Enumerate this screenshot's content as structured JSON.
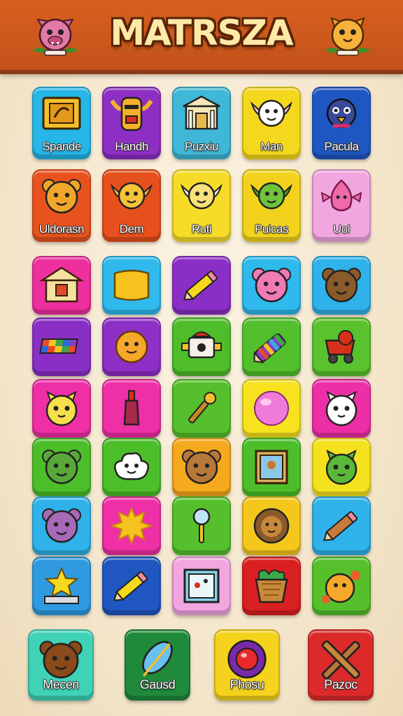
{
  "header": {
    "title": "MATRSZA"
  },
  "mascots": {
    "left": "pink-monster-icon",
    "right": "orange-cat-icon"
  },
  "rows": [
    [
      {
        "label": "Spande",
        "icon": "golden-frame-icon",
        "color": "#26b6e8"
      },
      {
        "label": "Handh",
        "icon": "tiki-mask-icon",
        "color": "#8e2fc4"
      },
      {
        "label": "Puzxiu",
        "icon": "temple-icon",
        "color": "#3fb7d6"
      },
      {
        "label": "Man",
        "icon": "winged-ghost-icon",
        "color": "#f4d81e"
      },
      {
        "label": "Pacula",
        "icon": "blue-bird-icon",
        "color": "#1f57c2"
      }
    ],
    [
      {
        "label": "Uldorasn",
        "icon": "lion-icon",
        "color": "#e8521f"
      },
      {
        "label": "Dem",
        "icon": "winged-mask-icon",
        "color": "#e5501c"
      },
      {
        "label": "Ruti",
        "icon": "angel-face-icon",
        "color": "#f6dc28"
      },
      {
        "label": "Puicas",
        "icon": "green-goblin-icon",
        "color": "#f2d21c"
      },
      {
        "label": "Uol",
        "icon": "pink-creature-icon",
        "color": "#f2a6e0"
      }
    ],
    [
      {
        "label": "",
        "icon": "shrine-icon",
        "color": "#ee2f9e"
      },
      {
        "label": "",
        "icon": "yellow-cushion-icon",
        "color": "#2fb9ec"
      },
      {
        "label": "",
        "icon": "pencil-icon",
        "color": "#8a2fc6"
      },
      {
        "label": "",
        "icon": "pink-bear-icon",
        "color": "#2fb9ec"
      },
      {
        "label": "",
        "icon": "brown-bear-icon",
        "color": "#2fb2ea"
      }
    ],
    [
      {
        "label": "",
        "icon": "color-blocks-icon",
        "color": "#8a2fc6"
      },
      {
        "label": "",
        "icon": "orange-cookie-icon",
        "color": "#8e2fc6"
      },
      {
        "label": "",
        "icon": "robot-head-icon",
        "color": "#4fbd2a"
      },
      {
        "label": "",
        "icon": "striped-crayon-icon",
        "color": "#52bf2c"
      },
      {
        "label": "",
        "icon": "red-cart-icon",
        "color": "#5ac22c"
      }
    ],
    [
      {
        "label": "",
        "icon": "yellow-cat-icon",
        "color": "#ee2fa6"
      },
      {
        "label": "",
        "icon": "bottle-icon",
        "color": "#ee2fa6"
      },
      {
        "label": "",
        "icon": "microphone-icon",
        "color": "#56c02c"
      },
      {
        "label": "",
        "icon": "pink-ball-icon",
        "color": "#f6e21e"
      },
      {
        "label": "",
        "icon": "white-cat-icon",
        "color": "#ec2fa6"
      }
    ],
    [
      {
        "label": "",
        "icon": "green-bear-icon",
        "color": "#4cbe2a"
      },
      {
        "label": "",
        "icon": "cloud-face-icon",
        "color": "#4cbe2a"
      },
      {
        "label": "",
        "icon": "teddy-bear-icon",
        "color": "#f5a91c"
      },
      {
        "label": "",
        "icon": "portrait-icon",
        "color": "#4cbe2a"
      },
      {
        "label": "",
        "icon": "green-cat-icon",
        "color": "#f5e21e"
      }
    ],
    [
      {
        "label": "",
        "icon": "purple-bear-icon",
        "color": "#2fb2ea"
      },
      {
        "label": "",
        "icon": "sun-icon",
        "color": "#ee2fa6"
      },
      {
        "label": "",
        "icon": "magnifier-icon",
        "color": "#56c02c"
      },
      {
        "label": "",
        "icon": "lion-face-icon",
        "color": "#f5c71c"
      },
      {
        "label": "",
        "icon": "pen-icon",
        "color": "#2fb2ea"
      }
    ],
    [
      {
        "label": "",
        "icon": "star-trophy-icon",
        "color": "#2f9ae0"
      },
      {
        "label": "",
        "icon": "pencil-icon",
        "color": "#1f56c0"
      },
      {
        "label": "",
        "icon": "picture-frame-icon",
        "color": "#f2a6e0"
      },
      {
        "label": "",
        "icon": "plant-basket-icon",
        "color": "#d92020"
      },
      {
        "label": "",
        "icon": "orange-blob-icon",
        "color": "#56c02c"
      }
    ]
  ],
  "bottom": [
    {
      "label": "Mecen",
      "icon": "bear-icon",
      "color": "#3fd2b6"
    },
    {
      "label": "Gausd",
      "icon": "feather-leaf-icon",
      "color": "#1f8a3a"
    },
    {
      "label": "Phosu",
      "icon": "red-button-icon",
      "color": "#f5d21c"
    },
    {
      "label": "Pazoc",
      "icon": "crossed-swords-icon",
      "color": "#dc2a2a"
    }
  ]
}
